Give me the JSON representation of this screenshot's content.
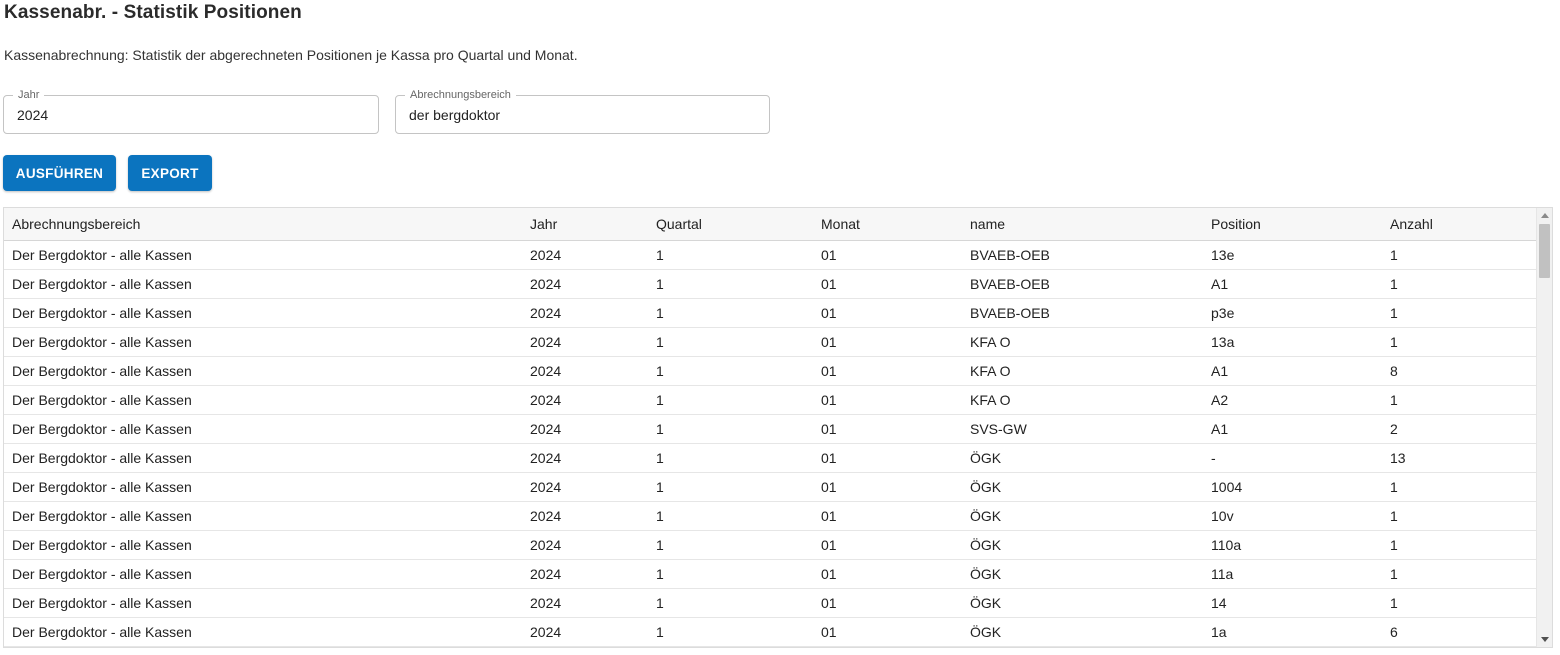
{
  "page": {
    "title": "Kassenabr. - Statistik Positionen",
    "description": "Kassenabrechnung: Statistik der abgerechneten Positionen je Kassa pro Quartal und Monat."
  },
  "filters": {
    "jahr_label": "Jahr",
    "jahr_value": "2024",
    "bereich_label": "Abrechnungsbereich",
    "bereich_value": "der bergdoktor"
  },
  "actions": {
    "run_label": "AUSFÜHREN",
    "export_label": "EXPORT"
  },
  "table": {
    "columns": [
      "Abrechnungsbereich",
      "Jahr",
      "Quartal",
      "Monat",
      "name",
      "Position",
      "Anzahl"
    ],
    "rows": [
      [
        "Der Bergdoktor - alle Kassen",
        "2024",
        "1",
        "01",
        "BVAEB-OEB",
        "13e",
        "1"
      ],
      [
        "Der Bergdoktor - alle Kassen",
        "2024",
        "1",
        "01",
        "BVAEB-OEB",
        "A1",
        "1"
      ],
      [
        "Der Bergdoktor - alle Kassen",
        "2024",
        "1",
        "01",
        "BVAEB-OEB",
        "p3e",
        "1"
      ],
      [
        "Der Bergdoktor - alle Kassen",
        "2024",
        "1",
        "01",
        "KFA O",
        "13a",
        "1"
      ],
      [
        "Der Bergdoktor - alle Kassen",
        "2024",
        "1",
        "01",
        "KFA O",
        "A1",
        "8"
      ],
      [
        "Der Bergdoktor - alle Kassen",
        "2024",
        "1",
        "01",
        "KFA O",
        "A2",
        "1"
      ],
      [
        "Der Bergdoktor - alle Kassen",
        "2024",
        "1",
        "01",
        "SVS-GW",
        "A1",
        "2"
      ],
      [
        "Der Bergdoktor - alle Kassen",
        "2024",
        "1",
        "01",
        "ÖGK",
        "-",
        "13"
      ],
      [
        "Der Bergdoktor - alle Kassen",
        "2024",
        "1",
        "01",
        "ÖGK",
        "1004",
        "1"
      ],
      [
        "Der Bergdoktor - alle Kassen",
        "2024",
        "1",
        "01",
        "ÖGK",
        "10v",
        "1"
      ],
      [
        "Der Bergdoktor - alle Kassen",
        "2024",
        "1",
        "01",
        "ÖGK",
        "110a",
        "1"
      ],
      [
        "Der Bergdoktor - alle Kassen",
        "2024",
        "1",
        "01",
        "ÖGK",
        "11a",
        "1"
      ],
      [
        "Der Bergdoktor - alle Kassen",
        "2024",
        "1",
        "01",
        "ÖGK",
        "14",
        "1"
      ],
      [
        "Der Bergdoktor - alle Kassen",
        "2024",
        "1",
        "01",
        "ÖGK",
        "1a",
        "6"
      ]
    ]
  },
  "colors": {
    "primary": "#0b74bf",
    "header_bg": "#f7f7f7"
  }
}
